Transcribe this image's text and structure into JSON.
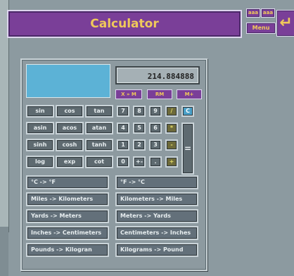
{
  "window": {
    "title": "Calculator",
    "controls": {
      "small1": "aaa",
      "small2": "aaa",
      "menu": "Menu",
      "enter_symbol": "↵"
    }
  },
  "calculator": {
    "display": "214.884888",
    "memory_buttons": [
      "X » M",
      "RM",
      "M+"
    ],
    "function_buttons": [
      [
        "sin",
        "cos",
        "tan"
      ],
      [
        "asin",
        "acos",
        "atan"
      ],
      [
        "sinh",
        "cosh",
        "tanh"
      ],
      [
        "log",
        "exp",
        "cot"
      ]
    ],
    "keypad_rows": [
      [
        "7",
        "8",
        "9",
        "/",
        "C"
      ],
      [
        "4",
        "5",
        "6",
        "*"
      ],
      [
        "1",
        "2",
        "3",
        "-"
      ],
      [
        "0",
        "+-",
        ".",
        "+"
      ]
    ],
    "equals": "=",
    "conversion_buttons": [
      [
        "°C -> °F",
        "°F -> °C"
      ],
      [
        "Miles -> Kilometers",
        "Kilometers -> Miles"
      ],
      [
        "Yards -> Meters",
        "Meters -> Yards"
      ],
      [
        "Inches -> Centimeters",
        "Centimeters -> Inches"
      ],
      [
        "Pounds -> Kilogran",
        "Kilograms -> Pound"
      ]
    ]
  },
  "colors": {
    "accent_purple": "#7a3f98",
    "accent_gold": "#f0c95a",
    "lcd_bg": "#a5b0b5",
    "blue_panel": "#5cb2d6"
  }
}
